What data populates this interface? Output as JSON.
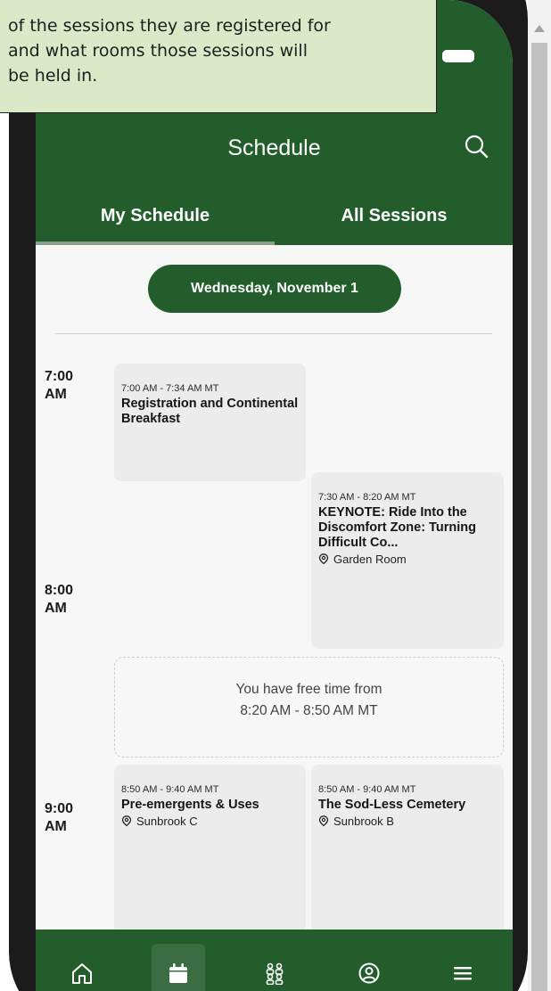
{
  "callout": {
    "lines": [
      "of the sessions they are registered for",
      "and what rooms those sessions will",
      "be held in."
    ]
  },
  "header": {
    "title": "Schedule"
  },
  "tabs": [
    {
      "label": "My Schedule",
      "active": true
    },
    {
      "label": "All Sessions",
      "active": false
    }
  ],
  "date_label": "Wednesday, November 1",
  "time_labels": [
    "7:00\nAM",
    "8:00\nAM",
    "9:00\nAM"
  ],
  "sessions": [
    {
      "time": "7:00 AM - 7:34 AM MT",
      "title": "Registration and Continental Breakfast",
      "room": ""
    },
    {
      "time": "7:30 AM - 8:20 AM MT",
      "title": "KEYNOTE: Ride Into the Discomfort Zone: Turning Difficult Co...",
      "room": "Garden Room"
    },
    {
      "time": "8:50 AM - 9:40 AM MT",
      "title": "Pre-emergents & Uses",
      "room": "Sunbrook C"
    },
    {
      "time": "8:50 AM - 9:40 AM MT",
      "title": "The Sod-Less Cemetery",
      "room": "Sunbrook B"
    }
  ],
  "free_time": {
    "line1": "You have free time from",
    "line2": "8:20 AM - 8:50 AM MT"
  },
  "nav": [
    "home-icon",
    "calendar-icon",
    "people-icon",
    "profile-icon",
    "menu-icon"
  ],
  "colors": {
    "brand_green": "#235d2c",
    "callout_bg": "#dbe9c8",
    "card_bg": "#ececec"
  }
}
